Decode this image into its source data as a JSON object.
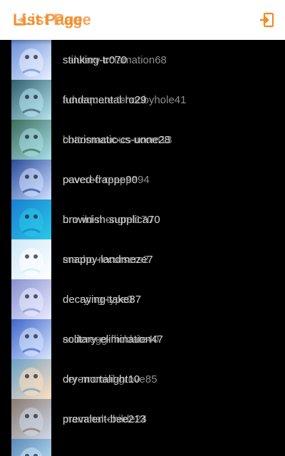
{
  "header": {
    "title_front": "List Page",
    "title_back": "List Page",
    "logout_icon": "logout-icon",
    "accent": "#f08a24"
  },
  "list": {
    "items": [
      {
        "label_a": "stinking-tr070",
        "label_b": "salutary-cclamation68",
        "color_a": "#6a8fd8",
        "color_b": "#e9f1ff"
      },
      {
        "label_a": "fundamental-ro29",
        "label_b": "aduequate-tchoobyhole41",
        "color_a": "#2f5f6a",
        "color_b": "#b7e3f0"
      },
      {
        "label_a": "charismatic-cs-unne28",
        "label_b": "bottomacuous-uoom13",
        "color_a": "#3d6b5a",
        "color_b": "#a8e0e8"
      },
      {
        "label_a": "paved-frappe90",
        "label_b": "covered-reappe94",
        "color_a": "#2a4a9a",
        "color_b": "#cfe0ff"
      },
      {
        "label_a": "brownish-supplica70",
        "label_b": "unwild-mongrel170",
        "color_a": "#1a7fd0",
        "color_b": "#2ac7e8"
      },
      {
        "label_a": "snappy-landmeze7",
        "label_b": "macho-recursers2",
        "color_a": "#cfe8f8",
        "color_b": "#ffffff"
      },
      {
        "label_a": "decaying-take87",
        "label_b": "decrying-type0",
        "color_a": "#8a8fd0",
        "color_b": "#e8ecff"
      },
      {
        "label_a": "solitary-elimination47",
        "label_b": "acderegg-flicldate40",
        "color_a": "#3f66c8",
        "color_b": "#d8e6ff"
      },
      {
        "label_a": "dry-mortalight10",
        "label_b": "ceremonial-grove85",
        "color_a": "#6aa0c8",
        "color_b": "#ffe0c0"
      },
      {
        "label_a": "prevalent-bee213",
        "label_b": "mammal-childe24",
        "color_a": "#8a7a70",
        "color_b": "#cfd8e8"
      },
      {
        "label_a": "",
        "label_b": "",
        "color_a": "#5a8ab8",
        "color_b": "#c8e8f8"
      }
    ]
  }
}
